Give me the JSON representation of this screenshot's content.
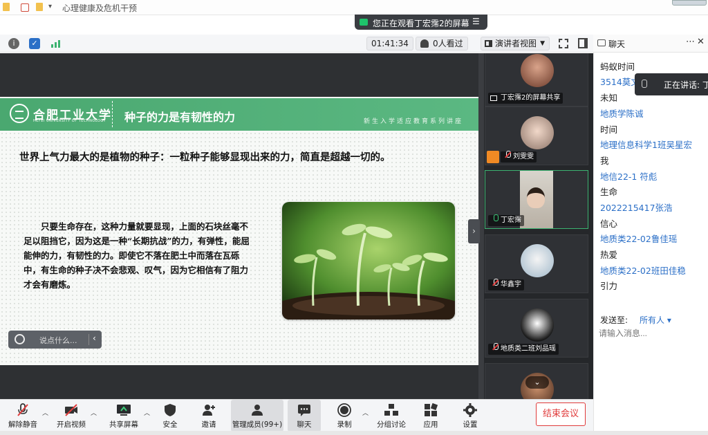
{
  "topbar": {
    "doc_title": "心理健康及危机干预"
  },
  "banner": {
    "text": "您正在观看丁宏霈2的屏幕"
  },
  "infobar": {
    "timer": "01:41:34",
    "viewers": "0人看过",
    "view_mode": "演讲者视图"
  },
  "slide": {
    "university": "合肥工业大学",
    "university_en": "HEFEI UNIVERSITY OF TECHNOLOGY",
    "title": "种子的力是有韧性的力",
    "subtitle": "新生入学适应教育系列讲座",
    "headline": "世界上气力最大的是植物的种子：一粒种子能够显现出来的力，简直是超越一切的。",
    "body": "只要生命存在，这种力量就要显现，上面的石块丝毫不足以阻挡它，因为这是一种“长期抗战”的力，有弹性，能屈能伸的力，有韧性的力。即使它不落在肥土中而落在瓦砾中，有生命的种子决不会悲观、叹气，因为它相信有了阻力才会有磨炼。"
  },
  "stage": {
    "chat_placeholder": "说点什么..."
  },
  "participants": [
    {
      "name": "丁宏霈2的屏幕共享",
      "mic": "screen"
    },
    {
      "name": "刘雯雯",
      "mic": "off"
    },
    {
      "name": "丁宏霈",
      "mic": "on"
    },
    {
      "name": "华鑫宇",
      "mic": "off"
    },
    {
      "name": "地质类二班刘品瑶",
      "mic": "off"
    }
  ],
  "toolbar": {
    "unmute": "解除静音",
    "video": "开启视频",
    "share": "共享屏幕",
    "security": "安全",
    "invite": "邀请",
    "members": "管理成员(99+)",
    "chat": "聊天",
    "record": "录制",
    "breakout": "分组讨论",
    "apps": "应用",
    "settings": "设置",
    "end": "结束会议"
  },
  "chat": {
    "title": "聊天",
    "messages": [
      {
        "sender": "",
        "text": "蚂蚁时间"
      },
      {
        "sender": "3514莫文",
        "text": "未知"
      },
      {
        "sender": "地质学陈诚",
        "text": "时间"
      },
      {
        "sender": "地理信息科学1班吴星宏",
        "text": "我"
      },
      {
        "sender": "地信22-1 符彪",
        "text": "生命"
      },
      {
        "sender": "2022215417张浩",
        "text": "信心"
      },
      {
        "sender": "地质类22-02鲁佳瑶",
        "text": "热爱"
      },
      {
        "sender": "地质类22-02班田佳稳",
        "text": "引力"
      }
    ],
    "speaking": "正在讲话: 丁",
    "send_to_label": "发送至:",
    "send_to_value": "所有人",
    "input_placeholder": "请输入消息..."
  },
  "colors": {
    "accent_green": "#4aa870",
    "link_blue": "#2b6fc7",
    "danger_red": "#e03a3a"
  }
}
